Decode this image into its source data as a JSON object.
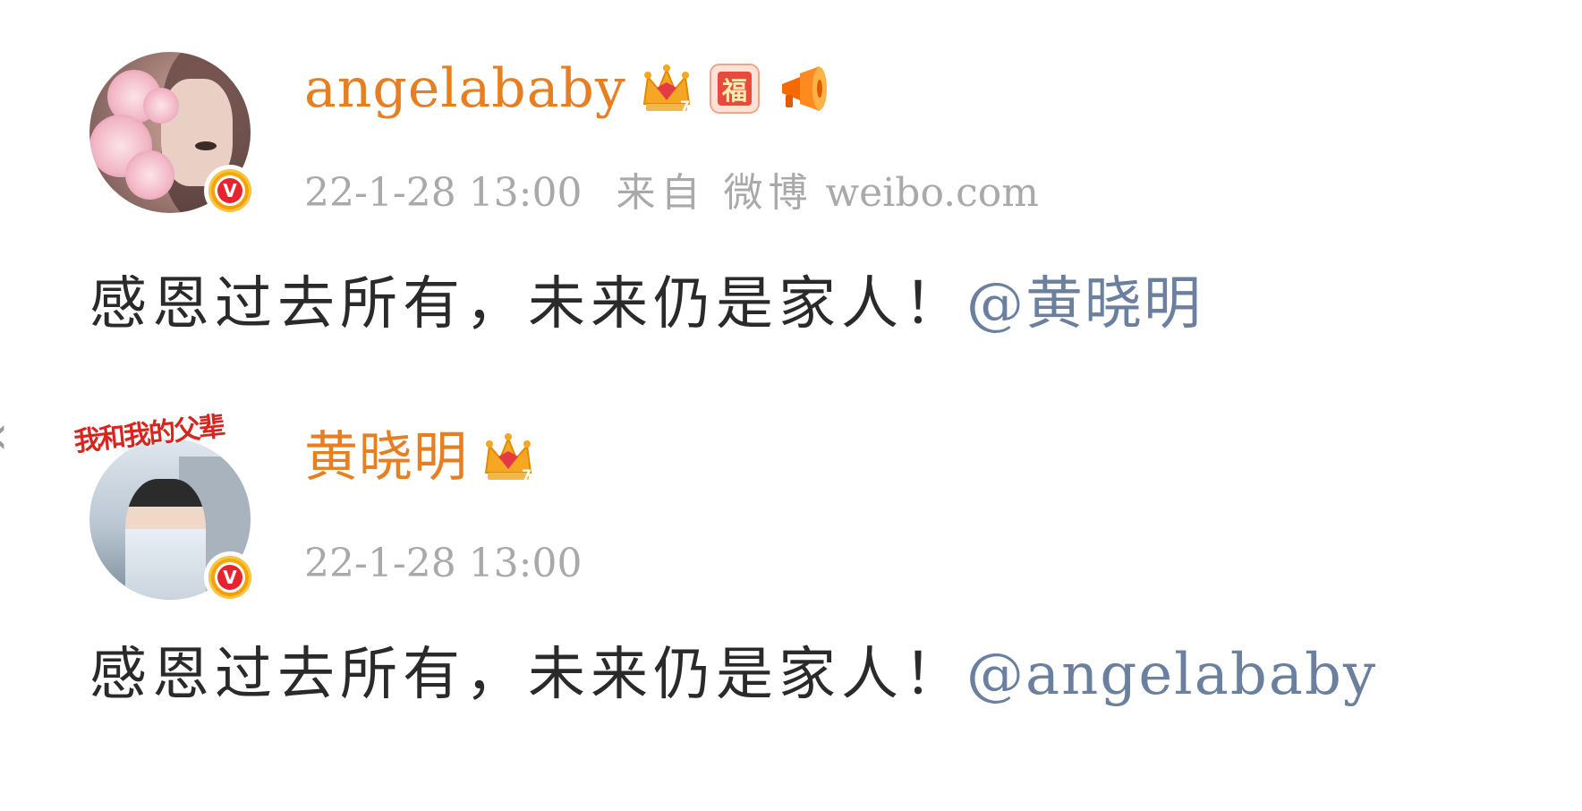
{
  "posts": [
    {
      "username": "angelababy",
      "badges": [
        "crown-vip-icon",
        "fu-badge-icon",
        "megaphone-icon"
      ],
      "timestamp": "22-1-28 13:00",
      "source_label": "来自 微博",
      "source_site": "weibo.com",
      "content_text": "感恩过去所有，未来仍是家人！",
      "mention": "@黄晓明",
      "verified": true
    },
    {
      "username": "黄晓明",
      "avatar_title": "我和我的父辈",
      "badges": [
        "crown-vip-icon"
      ],
      "timestamp": "22-1-28 13:00",
      "content_text": "感恩过去所有，未来仍是家人！",
      "mention": "@angelababy",
      "verified": true
    }
  ],
  "colors": {
    "username": "#e67e22",
    "timestamp": "#a9a9a9",
    "content": "#2a2a2a",
    "mention": "#6b7f9e",
    "verified_badge": "#f39a00"
  },
  "edge": {
    "chevron": "‹"
  }
}
